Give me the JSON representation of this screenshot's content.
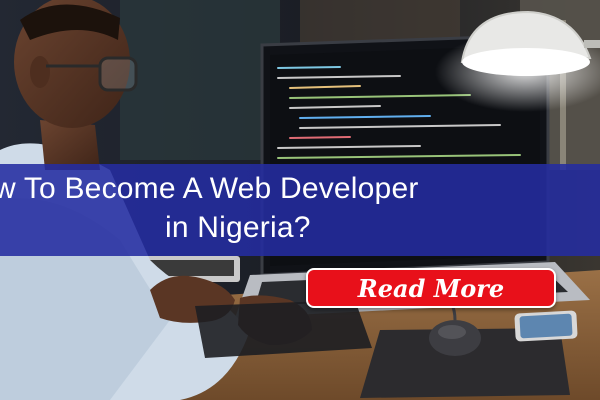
{
  "banner": {
    "title_line1": "w To Become A Web Developer",
    "title_line2": "in Nigeria?",
    "read_more_label": "Read More"
  },
  "colors": {
    "title_band": "#242ca0",
    "button_red": "#e8101a",
    "text_white": "#ffffff"
  },
  "icons": [
    "desk-lamp-icon",
    "laptop-icon",
    "computer-mouse-icon",
    "smartphone-icon"
  ]
}
